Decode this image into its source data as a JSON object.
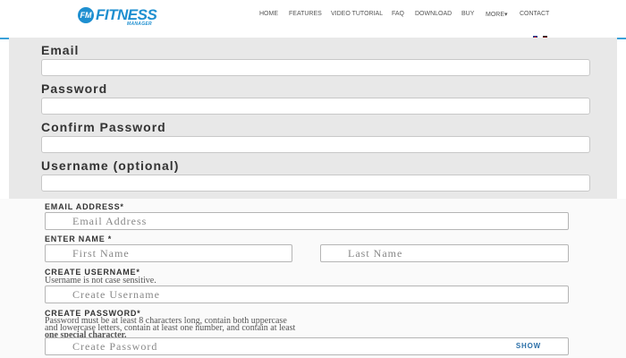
{
  "header": {
    "logo": {
      "badge": "FM",
      "title": "FITNESS",
      "subtitle": "MANAGER"
    },
    "nav": [
      "HOME",
      "FEATURES",
      "VIDEO TUTORIAL",
      "FAQ",
      "DOWNLOAD",
      "BUY",
      "MORE▾",
      "CONTACT"
    ],
    "accent_color": "#3aa1d8"
  },
  "upper_form": {
    "email_label": "Email",
    "password_label": "Password",
    "confirm_label": "Confirm Password",
    "username_label": "Username (optional)"
  },
  "signup_form": {
    "email_label": "EMAIL ADDRESS*",
    "email_placeholder": "Email Address",
    "name_label": "ENTER NAME *",
    "first_placeholder": "First Name",
    "last_placeholder": "Last Name",
    "username_label": "CREATE USERNAME*",
    "username_hint": "Username is not case sensitive.",
    "username_placeholder": "Create Username",
    "password_label": "CREATE PASSWORD*",
    "password_hint_1": "Password must be at least 8 characters long, contain both uppercase",
    "password_hint_2": "and lowercase letters, contain at least one number, and contain at least",
    "password_hint_3": "one special character.",
    "password_placeholder": "Create Password",
    "show_label": "SHOW"
  }
}
